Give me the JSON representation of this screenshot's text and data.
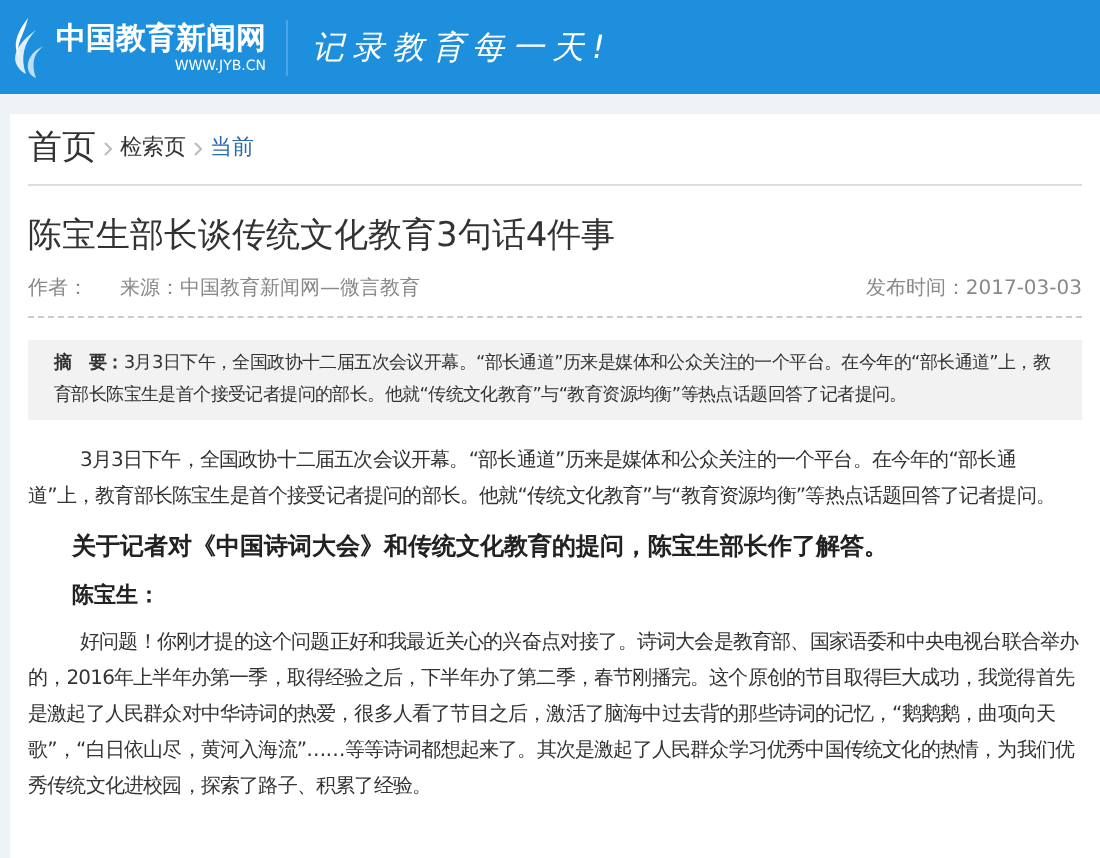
{
  "header": {
    "site_name": "中国教育新闻网",
    "site_url": "WWW.JYB.CN",
    "slogan": "记录教育每一天!"
  },
  "breadcrumb": [
    {
      "label": "首页",
      "kind": "home"
    },
    {
      "label": "检索页",
      "kind": "link"
    },
    {
      "label": "当前",
      "kind": "current"
    }
  ],
  "article": {
    "title": "陈宝生部长谈传统文化教育3句话4件事",
    "author_label": "作者：",
    "source": "来源：中国教育新闻网—微言教育",
    "published": "发布时间：2017-03-03",
    "summary_label": "摘　要：",
    "summary": "3月3日下午，全国政协十二届五次会议开幕。“部长通道”历来是媒体和公众关注的一个平台。在今年的“部长通道”上，教育部长陈宝生是首个接受记者提问的部长。他就“传统文化教育”与“教育资源均衡”等热点话题回答了记者提问。",
    "paragraphs": [
      {
        "kind": "body",
        "text": "3月3日下午，全国政协十二届五次会议开幕。“部长通道”历来是媒体和公众关注的一个平台。在今年的“部长通道”上，教育部长陈宝生是首个接受记者提问的部长。他就“传统文化教育”与“教育资源均衡”等热点话题回答了记者提问。"
      },
      {
        "kind": "heading",
        "text": "关于记者对《中国诗词大会》和传统文化教育的提问，陈宝生部长作了解答。"
      },
      {
        "kind": "speaker",
        "text": "陈宝生："
      },
      {
        "kind": "body",
        "text": "好问题！你刚才提的这个问题正好和我最近关心的兴奋点对接了。诗词大会是教育部、国家语委和中央电视台联合举办的，2016年上半年办第一季，取得经验之后，下半年办了第二季，春节刚播完。这个原创的节目取得巨大成功，我觉得首先是激起了人民群众对中华诗词的热爱，很多人看了节目之后，激活了脑海中过去背的那些诗词的记忆，“鹅鹅鹅，曲项向天歌”，“白日依山尽，黄河入海流”……等等诗词都想起来了。其次是激起了人民群众学习优秀中国传统文化的热情，为我们优秀传统文化进校园，探索了路子、积累了经验。"
      }
    ]
  }
}
